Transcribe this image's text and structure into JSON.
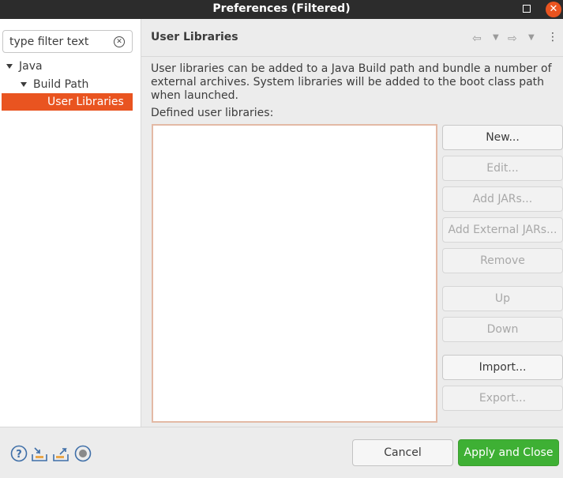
{
  "window": {
    "title": "Preferences (Filtered)"
  },
  "filter": {
    "placeholder": "type filter text"
  },
  "tree": {
    "java": "Java",
    "build_path": "Build Path",
    "user_libraries": "User Libraries"
  },
  "page": {
    "title": "User Libraries",
    "description": "User libraries can be added to a Java Build path and bundle a number of external archives. System libraries will be added to the boot class path when launched.",
    "list_label": "Defined user libraries:"
  },
  "buttons": {
    "new": "New...",
    "edit": "Edit...",
    "add_jars": "Add JARs...",
    "add_external_jars": "Add External JARs...",
    "remove": "Remove",
    "up": "Up",
    "down": "Down",
    "import": "Import...",
    "export": "Export..."
  },
  "footer": {
    "cancel": "Cancel",
    "apply_close": "Apply and Close"
  },
  "colors": {
    "accent": "#e95420",
    "apply": "#3eb034",
    "titlebar": "#2c2c2c"
  }
}
